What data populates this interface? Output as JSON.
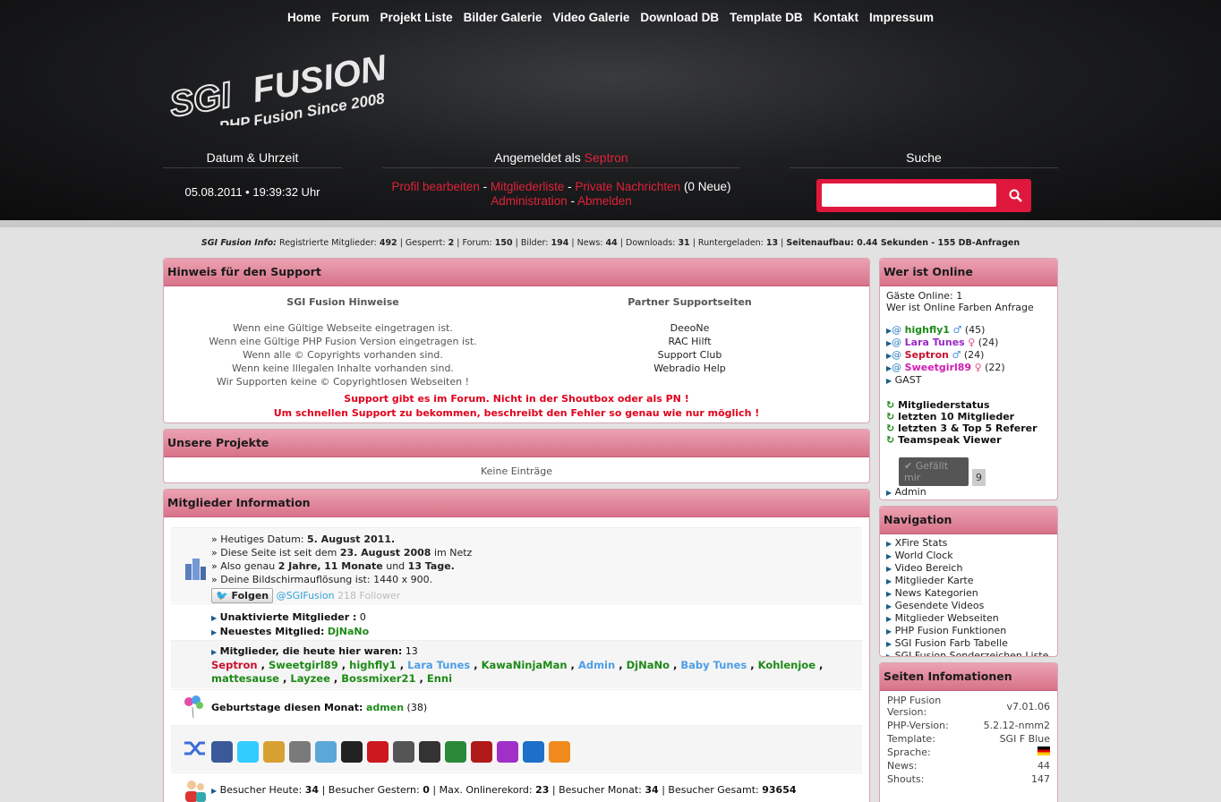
{
  "nav": [
    "Home",
    "Forum",
    "Projekt Liste",
    "Bilder Galerie",
    "Video Galerie",
    "Download DB",
    "Template DB",
    "Kontakt",
    "Impressum"
  ],
  "logo": {
    "line1": "SGI",
    "line2": "FUSION",
    "tagline": "PHP Fusion Since 2008"
  },
  "header": {
    "date_title": "Datum & Uhrzeit",
    "date_value": "05.08.2011 • 19:39:32 Uhr",
    "login_prefix": "Angemeldet als",
    "login_user": "Septron",
    "links": {
      "profile": "Profil bearbeiten",
      "members": "Mitgliederliste",
      "pm": "Private Nachrichten",
      "pm_new": "(0 Neue)",
      "admin": "Administration",
      "logout": "Abmelden"
    },
    "search_title": "Suche"
  },
  "info": {
    "label": "SGI Fusion Info:",
    "reg_label": "Registrierte Mitglieder:",
    "reg": "492",
    "blocked_label": "Gesperrt:",
    "blocked": "2",
    "forum_label": "Forum:",
    "forum": "150",
    "images_label": "Bilder:",
    "images": "194",
    "news_label": "News:",
    "news": "44",
    "dl_label": "Downloads:",
    "dl": "31",
    "dlc_label": "Runtergeladen:",
    "dlc": "13",
    "load": "Seitenaufbau: 0.44 Sekunden - 155 DB-Anfragen"
  },
  "support": {
    "title": "Hinweis für den Support",
    "col1_title": "SGI Fusion Hinweise",
    "col1": [
      "Wenn eine Gültige Webseite eingetragen ist.",
      "Wenn eine Gültige PHP Fusion Version eingetragen ist.",
      "Wenn alle © Copyrights vorhanden sind.",
      "Wenn keine Illegalen Inhalte vorhanden sind.",
      "Wir Supporten keine © Copyrightlosen Webseiten !"
    ],
    "col2_title": "Partner Supportseiten",
    "col2": [
      "DeeoNe",
      "RAC Hilft",
      "Support Club",
      "Webradio Help"
    ],
    "warn1": "Support gibt es im Forum. Nicht in der Shoutbox oder als PN !",
    "warn2": "Um schnellen Support zu bekommen, beschreibt den Fehler so genau wie nur möglich !"
  },
  "projects": {
    "title": "Unsere Projekte",
    "empty": "Keine Einträge"
  },
  "members": {
    "title": "Mitglieder Information",
    "today_label": "» Heutiges Datum:",
    "today": "5. August 2011.",
    "since_label": "» Diese Seite ist seit dem",
    "since": "23. August 2008",
    "since_suffix": "im Netz",
    "age_label": "» Also genau",
    "age1": "2 Jahre,",
    "age2": "11 Monate",
    "age_and": "und",
    "age3": "13 Tage.",
    "res": "» Deine Bildschirmauflösung ist: 1440 x 900.",
    "follow": "Folgen",
    "handle": "@SGIFusion",
    "followers": "218 Follower",
    "inactive_label": "Unaktivierte Mitglieder :",
    "inactive": "0",
    "newest_label": "Neuestes Mitglied:",
    "newest": "DjNaNo",
    "today_members_label": "Mitglieder, die heute hier waren:",
    "today_members_count": "13",
    "today_members": [
      "Septron",
      "Sweetgirl89",
      "highfly1",
      "Lara Tunes",
      "KawaNinjaMan",
      "Admin",
      "DjNaNo",
      "Baby Tunes",
      "Kohlenjoe",
      "mattesause",
      "Layzee",
      "Bossmixer21",
      "Enni"
    ],
    "bday_label": "Geburtstage diesen Monat:",
    "bday_user": "admen",
    "bday_age": "(38)",
    "visitors": {
      "today_label": "Besucher Heute:",
      "today": "34",
      "yesterday_label": "Besucher Gestern:",
      "yesterday": "0",
      "max_label": "Max. Onlinerekord:",
      "max": "23",
      "month_label": "Besucher Monat:",
      "month": "34",
      "total_label": "Besucher Gesamt:",
      "total": "93654"
    }
  },
  "online": {
    "title": "Wer ist Online",
    "guests": "Gäste Online: 1",
    "colors_label": "Wer ist Online Farben",
    "colors_link": "Anfrage",
    "users": [
      {
        "name": "highfly1",
        "age": "(45)",
        "color": "#1d8a17",
        "sex": "♂"
      },
      {
        "name": "Lara Tunes",
        "age": "(24)",
        "color": "#9b27c8",
        "sex": "♀"
      },
      {
        "name": "Septron",
        "age": "(24)",
        "color": "#c8102e",
        "sex": "♂"
      },
      {
        "name": "Sweetgirl89",
        "age": "(22)",
        "color": "#d11bb5",
        "sex": "♀"
      }
    ],
    "guest": "GAST",
    "links": [
      "Mitgliederstatus",
      "letzten 10 Mitglieder",
      "letzten 3 & Top 5 Referer",
      "Teamspeak Viewer"
    ],
    "like": "Gefällt mir",
    "like_count": "9",
    "admin": "Admin"
  },
  "navigation": {
    "title": "Navigation",
    "items": [
      "XFire Stats",
      "World Clock",
      "Video Bereich",
      "Mitglieder Karte",
      "News Kategorien",
      "Gesendete Videos",
      "Mitglieder Webseiten",
      "PHP Fusion Funktionen",
      "SGI Fusion Farb Tabelle",
      "SGI Fusion Sonderzeichen Liste"
    ]
  },
  "siteinfo": {
    "title": "Seiten Infomationen",
    "rows": [
      {
        "k": "PHP Fusion Version:",
        "v": "v7.01.06"
      },
      {
        "k": "PHP-Version:",
        "v": "5.2.12-nmm2"
      },
      {
        "k": "Template:",
        "v": "SGI F Blue"
      },
      {
        "k": "Sprache:",
        "v": ""
      },
      {
        "k": "News:",
        "v": "44"
      },
      {
        "k": "Shouts:",
        "v": "147"
      }
    ]
  },
  "colors": {
    "accent": "#e0173d",
    "panel_head": "#d87289"
  }
}
